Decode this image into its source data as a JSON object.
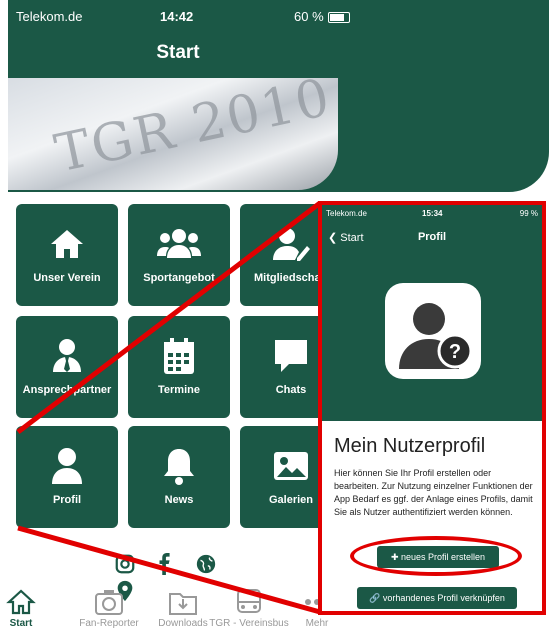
{
  "status_bar": {
    "carrier": "Telekom.de",
    "time": "14:42",
    "battery": "60 %"
  },
  "header": {
    "title": "Start",
    "banner_text": "TGR 2010"
  },
  "tiles": [
    {
      "label": "Unser Verein",
      "icon": "home-icon"
    },
    {
      "label": "Sportangebot",
      "icon": "group-icon"
    },
    {
      "label": "Mitgliedschaft",
      "icon": "member-edit-icon"
    },
    {
      "label": "Ansprechpartner",
      "icon": "contact-person-icon"
    },
    {
      "label": "Termine",
      "icon": "calendar-icon"
    },
    {
      "label": "Chats",
      "icon": "chat-icon"
    },
    {
      "label": "Profil",
      "icon": "user-icon"
    },
    {
      "label": "News",
      "icon": "bell-icon"
    },
    {
      "label": "Galerien",
      "icon": "image-icon"
    }
  ],
  "social": [
    "instagram-icon",
    "facebook-icon",
    "globe-icon",
    "location-pin-icon"
  ],
  "tabbar": [
    {
      "label": "Start",
      "icon": "home-icon",
      "active": true
    },
    {
      "label": "Fan-Reporter",
      "icon": "camera-icon",
      "active": false
    },
    {
      "label": "Downloads",
      "icon": "download-folder-icon",
      "active": false
    },
    {
      "label": "TGR - Vereinsbus",
      "icon": "bus-icon",
      "active": false
    },
    {
      "label": "Mehr",
      "icon": "more-icon",
      "active": false
    }
  ],
  "inset": {
    "status": {
      "carrier": "Telekom.de",
      "time": "15:34",
      "battery": "99 %"
    },
    "back_label": "Start",
    "title": "Profil",
    "heading": "Mein Nutzerprofil",
    "description": "Hier können Sie Ihr Profil erstellen oder bearbeiten. Zur Nutzung einzelner Funktionen der App Bedarf es ggf. der Anlage eines Profils, damit Sie als Nutzer authentifiziert werden können.",
    "btn_new": "neues Profil erstellen",
    "btn_link": "vorhandenes Profil verknüpfen"
  },
  "colors": {
    "primary": "#1b5846",
    "highlight": "#e10000"
  }
}
